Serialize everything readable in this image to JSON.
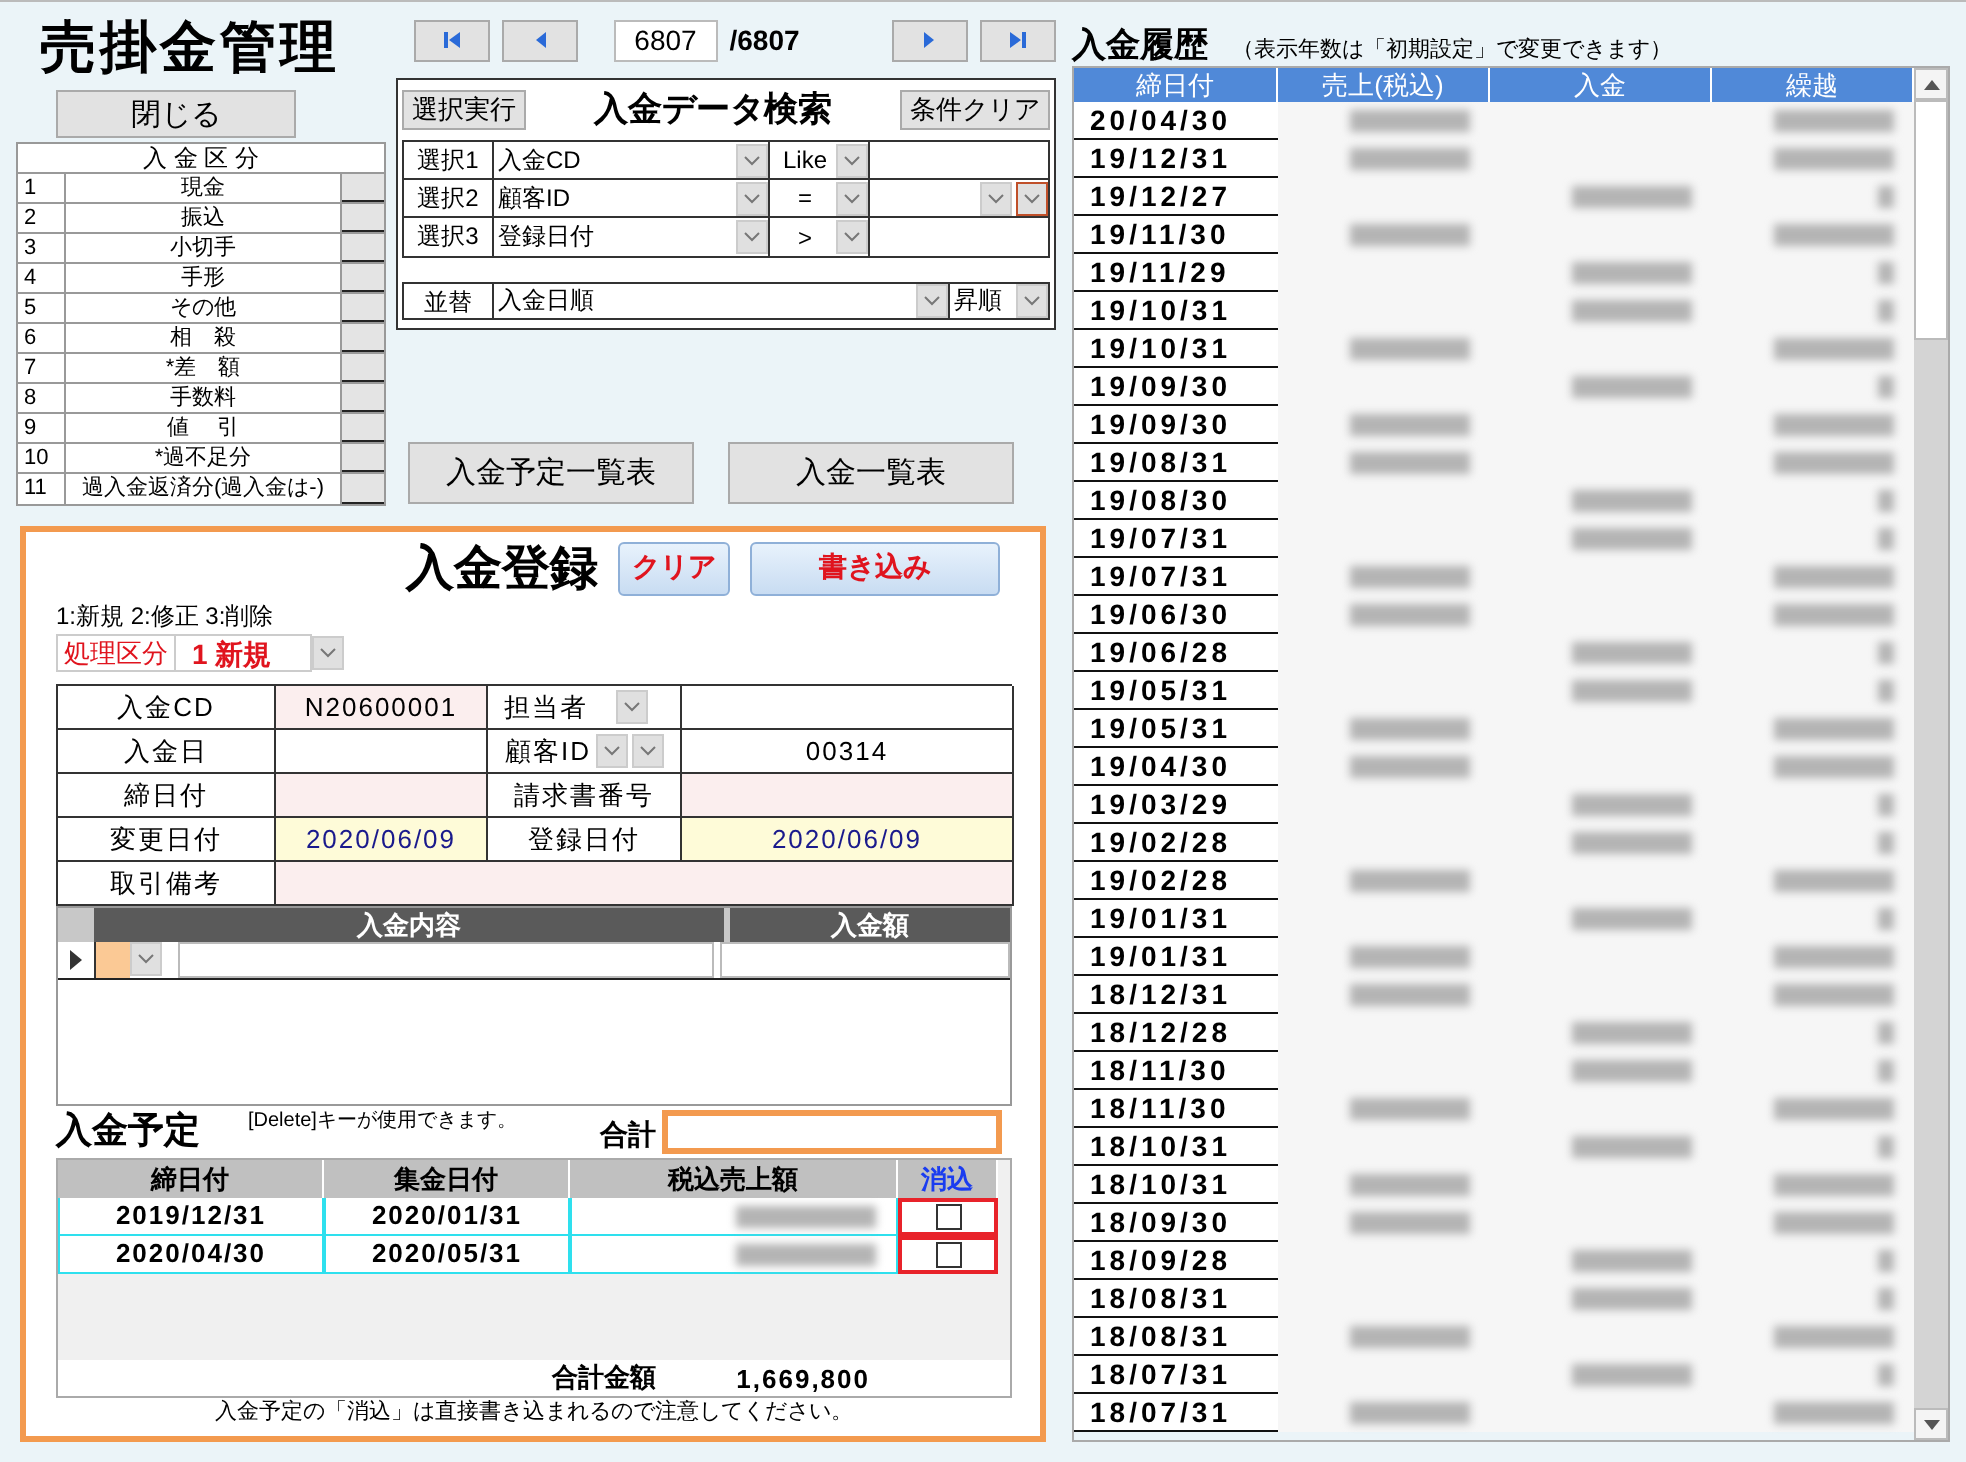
{
  "app_title": "売掛金管理",
  "close_button": "閉じる",
  "category_table": {
    "title": "入 金 区 分",
    "rows": [
      {
        "no": "1",
        "label": "現金"
      },
      {
        "no": "2",
        "label": "振込"
      },
      {
        "no": "3",
        "label": "小切手"
      },
      {
        "no": "4",
        "label": "手形"
      },
      {
        "no": "5",
        "label": "その他"
      },
      {
        "no": "6",
        "label": "相　殺"
      },
      {
        "no": "7",
        "label": "*差　額"
      },
      {
        "no": "8",
        "label": "手数料"
      },
      {
        "no": "9",
        "label": "値　 引"
      },
      {
        "no": "10",
        "label": "*過不足分"
      },
      {
        "no": "11",
        "label": "過入金返済分(過入金は-)"
      }
    ]
  },
  "navigator": {
    "current": "6807",
    "total": "/6807"
  },
  "search": {
    "run_button": "選択実行",
    "title": "入金データ検索",
    "clear_button": "条件クリア",
    "conditions": [
      {
        "label": "選択1",
        "field": "入金CD",
        "operator": "Like",
        "value_dropdown": false
      },
      {
        "label": "選択2",
        "field": "顧客ID",
        "operator": "=",
        "value_dropdown": true
      },
      {
        "label": "選択3",
        "field": "登録日付",
        "operator": ">",
        "value_dropdown": false
      }
    ],
    "sort": {
      "label": "並替",
      "field": "入金日順",
      "order": "昇順"
    }
  },
  "report_buttons": [
    "入金予定一覧表",
    "入金一覧表"
  ],
  "entry": {
    "title": "入金登録",
    "clear_button": "クリア",
    "write_button": "書き込み",
    "mode_hint": "1:新規 2:修正 3:削除",
    "mode_label": "処理区分",
    "mode_value": "1 新規",
    "code": {
      "label": "入金CD",
      "value": "N20600001"
    },
    "staff": {
      "label": "担当者"
    },
    "deposit_date": {
      "label": "入金日"
    },
    "customer": {
      "label": "顧客ID",
      "value": "00314"
    },
    "closing_date": {
      "label": "締日付"
    },
    "invoice_no": {
      "label": "請求書番号"
    },
    "changed": {
      "label": "変更日付",
      "value": "2020/06/09"
    },
    "registered": {
      "label": "登録日付",
      "value": "2020/06/09"
    },
    "remarks": {
      "label": "取引備考"
    },
    "detail_columns": [
      "入金内容",
      "入金額"
    ],
    "delete_hint": "[Delete]キーが使用できます。",
    "total_label": "合計"
  },
  "schedule": {
    "title": "入金予定",
    "columns": [
      "締日付",
      "集金日付",
      "税込売上額",
      "消込"
    ],
    "rows": [
      {
        "closing": "2019/12/31",
        "collection": "2020/01/31",
        "cleared": false
      },
      {
        "closing": "2020/04/30",
        "collection": "2020/05/31",
        "cleared": false
      }
    ],
    "total_label": "合計金額",
    "total": "1,669,800",
    "note": "入金予定の「消込」は直接書き込まれるので注意してください。"
  },
  "history": {
    "title": "入金履歴",
    "note": "（表示年数は「初期設定」で変更できます）",
    "columns": [
      "締日付",
      "売上(税込)",
      "入金",
      "繰越"
    ],
    "rows": [
      {
        "date": "20/04/30",
        "kind": "sale"
      },
      {
        "date": "19/12/31",
        "kind": "sale"
      },
      {
        "date": "19/12/27",
        "kind": "payment"
      },
      {
        "date": "19/11/30",
        "kind": "sale"
      },
      {
        "date": "19/11/29",
        "kind": "payment"
      },
      {
        "date": "19/10/31",
        "kind": "payment"
      },
      {
        "date": "19/10/31",
        "kind": "sale"
      },
      {
        "date": "19/09/30",
        "kind": "payment"
      },
      {
        "date": "19/09/30",
        "kind": "sale"
      },
      {
        "date": "19/08/31",
        "kind": "sale"
      },
      {
        "date": "19/08/30",
        "kind": "payment"
      },
      {
        "date": "19/07/31",
        "kind": "payment"
      },
      {
        "date": "19/07/31",
        "kind": "sale"
      },
      {
        "date": "19/06/30",
        "kind": "sale"
      },
      {
        "date": "19/06/28",
        "kind": "payment"
      },
      {
        "date": "19/05/31",
        "kind": "payment"
      },
      {
        "date": "19/05/31",
        "kind": "sale"
      },
      {
        "date": "19/04/30",
        "kind": "sale"
      },
      {
        "date": "19/03/29",
        "kind": "payment"
      },
      {
        "date": "19/02/28",
        "kind": "payment"
      },
      {
        "date": "19/02/28",
        "kind": "sale"
      },
      {
        "date": "19/01/31",
        "kind": "payment"
      },
      {
        "date": "19/01/31",
        "kind": "sale"
      },
      {
        "date": "18/12/31",
        "kind": "sale"
      },
      {
        "date": "18/12/28",
        "kind": "payment"
      },
      {
        "date": "18/11/30",
        "kind": "payment"
      },
      {
        "date": "18/11/30",
        "kind": "sale"
      },
      {
        "date": "18/10/31",
        "kind": "payment"
      },
      {
        "date": "18/10/31",
        "kind": "sale"
      },
      {
        "date": "18/09/30",
        "kind": "sale"
      },
      {
        "date": "18/09/28",
        "kind": "payment"
      },
      {
        "date": "18/08/31",
        "kind": "payment"
      },
      {
        "date": "18/08/31",
        "kind": "sale"
      },
      {
        "date": "18/07/31",
        "kind": "payment"
      },
      {
        "date": "18/07/31",
        "kind": "sale"
      }
    ]
  }
}
